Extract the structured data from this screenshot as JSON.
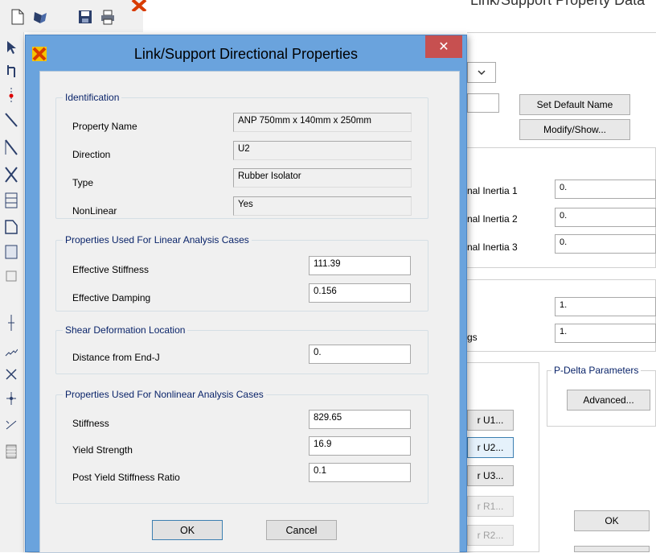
{
  "background_window": {
    "title": "Link/Support Property Data",
    "set_default_name_label": "Set Default Name",
    "modify_show_label": "Modify/Show...",
    "inertia_rows": [
      {
        "label": "nal Inertia 1",
        "value": "0."
      },
      {
        "label": "nal Inertia 2",
        "value": "0."
      },
      {
        "label": "nal Inertia 3",
        "value": "0."
      }
    ],
    "factor_value_1": "1.",
    "factor_label_2": "gs",
    "factor_value_2": "1.",
    "pdelta_legend": "P-Delta Parameters",
    "advanced_label": "Advanced...",
    "direction_buttons": [
      "r U1...",
      "r U2...",
      "r U3...",
      "r R1...",
      "r R2..."
    ],
    "ok_label": "OK"
  },
  "dialog": {
    "title": "Link/Support Directional Properties",
    "close_glyph": "✕",
    "identification": {
      "legend": "Identification",
      "rows": [
        {
          "label": "Property Name",
          "value": "ANP 750mm x 140mm x 250mm"
        },
        {
          "label": "Direction",
          "value": "U2"
        },
        {
          "label": "Type",
          "value": "Rubber Isolator"
        },
        {
          "label": "NonLinear",
          "value": "Yes"
        }
      ]
    },
    "linear": {
      "legend": "Properties Used For Linear Analysis Cases",
      "rows": [
        {
          "label": "Effective Stiffness",
          "value": "111.39"
        },
        {
          "label": "Effective Damping",
          "value": "0.156"
        }
      ]
    },
    "shear": {
      "legend": "Shear Deformation Location",
      "rows": [
        {
          "label": "Distance from End-J",
          "value": "0."
        }
      ]
    },
    "nonlinear": {
      "legend": "Properties Used For Nonlinear Analysis Cases",
      "rows": [
        {
          "label": "Stiffness",
          "value": "829.65"
        },
        {
          "label": "Yield Strength",
          "value": "16.9"
        },
        {
          "label": "Post Yield Stiffness Ratio",
          "value": "0.1"
        }
      ]
    },
    "ok_label": "OK",
    "cancel_label": "Cancel"
  },
  "toolbar_icons": [
    "new-file-icon",
    "open-folder-icon",
    "save-icon",
    "print-icon"
  ],
  "colors": {
    "title_bar": "#6aa3dd",
    "close_button": "#c75050",
    "group_legend_text": "#0a246a",
    "client_background": "#f0f0f0"
  }
}
